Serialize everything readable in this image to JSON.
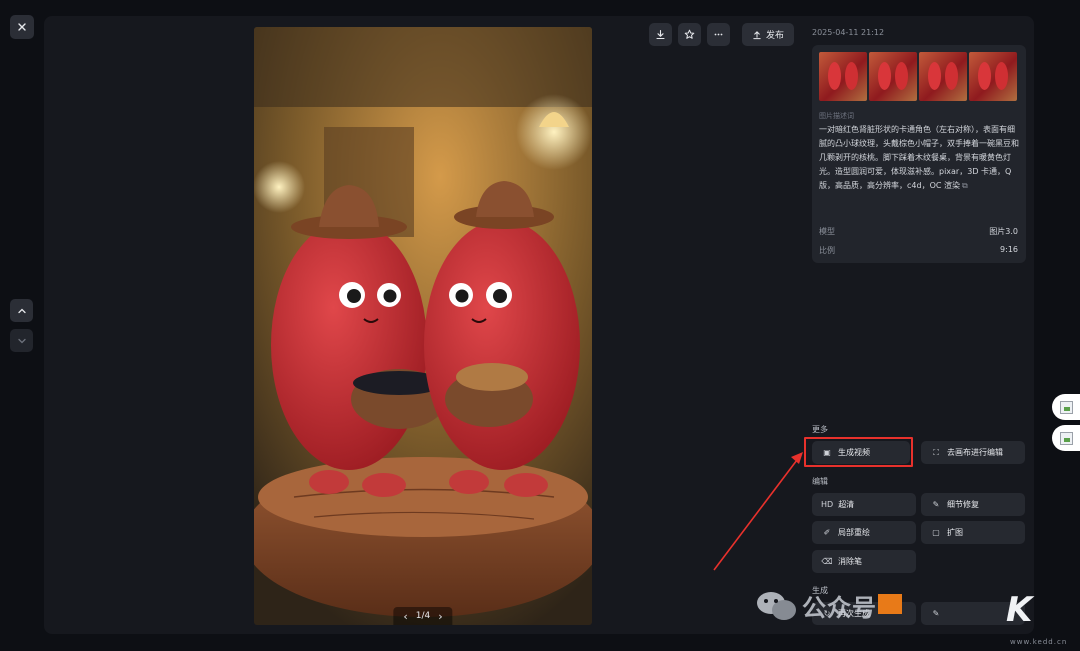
{
  "toolbar": {
    "publish_label": "发布",
    "icons": [
      "download-icon",
      "star-icon",
      "more-icon",
      "upload-icon"
    ]
  },
  "timestamp": "2025-04-11 21:12",
  "info": {
    "description_label": "图片描述词",
    "description": "一对暗红色肾脏形状的卡通角色（左右对称），表面有细腻的凸小球纹理，头戴棕色小帽子，双手捧着一碗黑豆和几颗剥开的核桃。脚下踩着木纹餐桌，背景有暖黄色灯光。造型圆润可爱，体现滋补感。pixar，3D 卡通，Q 版，高品质，高分辨率，c4d，OC 渲染",
    "model_label": "模型",
    "model_value": "图片3.0",
    "ratio_label": "比例",
    "ratio_value": "9:16"
  },
  "pager": {
    "text": "1/4"
  },
  "sections": {
    "more_label": "更多",
    "edit_label": "编辑",
    "generate_label": "生成"
  },
  "actions": {
    "generate_video": "生成视频",
    "canvas_edit": "去画布进行编辑",
    "hd_prefix": "HD",
    "upscale": "超清",
    "detail_repair": "细节修复",
    "partial_repaint": "局部重绘",
    "expand": "扩图",
    "eraser": "消除笔",
    "regenerate": "再次生成"
  },
  "watermark": {
    "text": "公众号",
    "logo": "K",
    "url": "www.kedd.cn"
  },
  "colors": {
    "background": "#0d0f14",
    "panel": "#16181e",
    "card": "#22252c",
    "highlight": "#e8312c"
  }
}
